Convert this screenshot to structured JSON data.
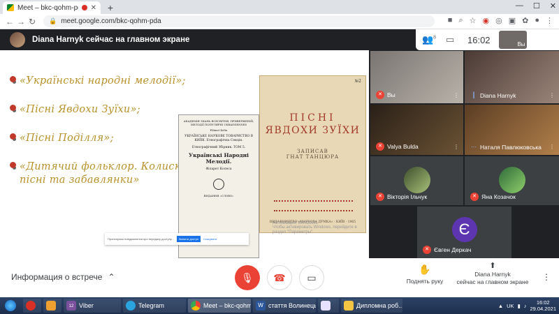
{
  "browser": {
    "tab_title": "Meet – bkc-qohm-pda",
    "tab_close": "✕",
    "new_tab": "+",
    "url": "meet.google.com/bkc-qohm-pda"
  },
  "meet": {
    "presenting_banner": "Diana Harnyk сейчас на главном экране",
    "participants_count": "8",
    "time": "16:02",
    "self_mini_label": "Вы"
  },
  "slide": {
    "bullets": [
      "«Українські народні мелодії»;",
      "«Пісні Явдохи Зуїхи»;",
      "«Пісні Поділля»;",
      "«Дитячий фольклор. Колискові пісні та забавлянки»"
    ],
    "book1": {
      "header_text": "АКАДЕМІЯ ЗНАНЬ ВСЕСВІТНЯ, ПРИВЕРЖЕНІЙ, МЕЛОДІЇ ПОПУЛЯРНІ UKRAINIENNES",
      "author_top": "Filimet Kolta",
      "society": "УКРАЇНСЬКЕ НАУКОВЕ ТОВАРИСТВО В КИЇВІ. Етнографічна Секція.",
      "series": "Етнографічний Збірник. ТОМ 5.",
      "title": "Українські Народні Мелодії.",
      "author": "Філарет Колеса",
      "publisher": "ВИДАННЯ «СЛОВО»"
    },
    "book2": {
      "title_line1": "ПІСНІ",
      "title_line2": "ЯВДОХИ ЗУЇХИ",
      "recorded_by": "ЗАПИСАВ",
      "recorder": "ГНАТ ТАНЦЮРА",
      "publisher": "ВИДАВНИЦТВО «НАУКОВА ДУМКА» · КИЇВ · 1965",
      "shelfmark": "№2"
    },
    "watermark_title": "Активация Windows",
    "watermark_text": "Чтобы активировать Windows, перейдите в раздел \"Параметры\".",
    "notice_text": "Пропонуємо повідомлення про передачу доступу...",
    "notice_button": "Змінити доступ",
    "notice_link": "Скасувати"
  },
  "participants": [
    {
      "name": "Вы",
      "muted": true
    },
    {
      "name": "Diana Harnyk",
      "muted": false
    },
    {
      "name": "Valya Bulda",
      "muted": true
    },
    {
      "name": "Наталя Павлюковська",
      "muted": false
    },
    {
      "name": "Вікторія Ільчук",
      "muted": true
    },
    {
      "name": "Яна Козачок",
      "muted": true
    },
    {
      "name": "Євген Деркач",
      "muted": true,
      "initial": "Є"
    }
  ],
  "controls": {
    "meeting_info": "Информация о встрече",
    "raise_hand": "Поднять руку",
    "presenting_line1": "Diana Harnyk",
    "presenting_line2": "сейчас на главном экране"
  },
  "taskbar": {
    "items": [
      "Viber",
      "Telegram",
      "Meet – bkc-qohm-...",
      "стаття Волинець...",
      "",
      "Дипломна роб..."
    ],
    "viber_badge": "12",
    "language": "UK",
    "time": "16:02",
    "date": "29.04.2021"
  },
  "colors": {
    "meet_dark": "#202124",
    "danger": "#ea4335",
    "slide_text": "#b8912a",
    "accent_blue": "#1a73e8"
  }
}
